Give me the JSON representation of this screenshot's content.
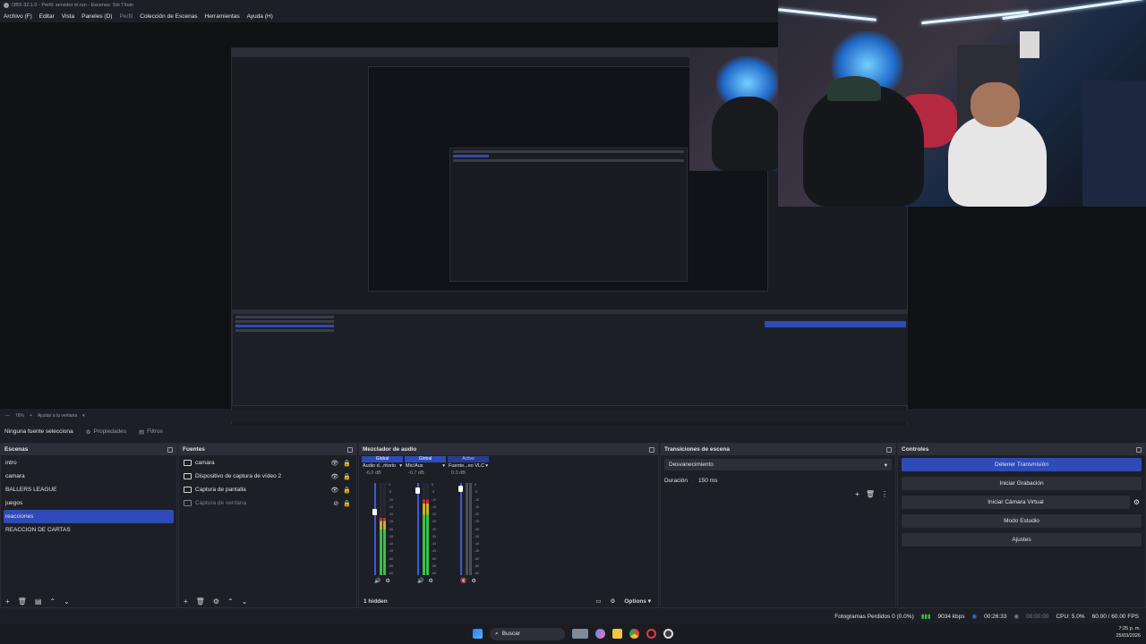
{
  "window": {
    "title": "OBS 32.1.0 - Perfil: servidor irl.run - Escenas: Sin Título"
  },
  "menu": [
    {
      "label": "Archivo (F)",
      "dim": false
    },
    {
      "label": "Editar",
      "dim": false
    },
    {
      "label": "Vista",
      "dim": false
    },
    {
      "label": "Paneles (D)",
      "dim": false
    },
    {
      "label": "Perfil",
      "dim": true
    },
    {
      "label": "Colección de Escenas",
      "dim": false
    },
    {
      "label": "Herramientas",
      "dim": false
    },
    {
      "label": "Ayuda (H)",
      "dim": false
    }
  ],
  "zoom": {
    "value": "76%",
    "mode": "Ajustar a la ventana"
  },
  "context": {
    "source": "Ninguna fuente selecciona",
    "properties": "Propiedades",
    "filters": "Filtros"
  },
  "scenes": {
    "title": "Escenas",
    "items": [
      {
        "label": "intro",
        "selected": false
      },
      {
        "label": "camara",
        "selected": false
      },
      {
        "label": "BALLERS LEAGUE",
        "selected": false
      },
      {
        "label": "juegos",
        "selected": false
      },
      {
        "label": "reacciones",
        "selected": true
      },
      {
        "label": "REACCION DE CARTAS",
        "selected": false
      }
    ]
  },
  "sources": {
    "title": "Fuentes",
    "items": [
      {
        "label": "camara",
        "icon": "list-icon",
        "visible": true
      },
      {
        "label": "Dispositivo de captura de vídeo 2",
        "icon": "camera-icon",
        "visible": true
      },
      {
        "label": "Captura de pantalla",
        "icon": "monitor-icon",
        "visible": true
      },
      {
        "label": "Captura de ventana",
        "icon": "window-icon",
        "visible": false
      }
    ]
  },
  "mixer": {
    "title": "Mezclador de audio",
    "channels": [
      {
        "header": "Global",
        "name": "Audio d...ritorio",
        "db": "-6.0 dB",
        "level": 0.62,
        "fader": 0.72,
        "active": false
      },
      {
        "header": "Global",
        "name": "Mic/Aux",
        "db": "-0.7 dB",
        "level": 0.82,
        "fader": 0.95,
        "active": false
      },
      {
        "header": "Activo",
        "name": "Fuente...eo VLC",
        "db": "0.0 dB",
        "level": 0.0,
        "fader": 0.97,
        "active": true
      }
    ],
    "hidden": "1 hidden",
    "options": "Options",
    "ticks": [
      "0",
      "-5",
      "-10",
      "-15",
      "-20",
      "-25",
      "-30",
      "-35",
      "-40",
      "-45",
      "-50",
      "-55",
      "-60"
    ]
  },
  "transitions": {
    "title": "Transiciones de escena",
    "type": "Desvanecimiento",
    "duration_label": "Duración",
    "duration_value": "150 ms"
  },
  "controls": {
    "title": "Controles",
    "buttons": [
      {
        "label": "Detener Transmisión",
        "primary": true
      },
      {
        "label": "Iniciar Grabación",
        "primary": false
      },
      {
        "label": "Iniciar Cámara Virtual",
        "primary": false
      },
      {
        "label": "Modo Estudio",
        "primary": false
      },
      {
        "label": "Ajustes",
        "primary": false
      }
    ]
  },
  "status": {
    "dropped": "Fotogramas Perdidos 0 (0.0%)",
    "bitrate": "9034 kbps",
    "stream_time": "00:26:33",
    "rec_time": "00:00:00",
    "cpu": "CPU: 5.0%",
    "fps": "60.00 / 60.00 FPS"
  },
  "taskbar": {
    "search": "Buscar",
    "time": "7:25 p. m.",
    "date": "25/03/2026"
  },
  "colors": {
    "accent": "#2f4bb8",
    "bg": "#1d1f26",
    "meter_green": "#3cc04a",
    "meter_yellow": "#c7b22a",
    "meter_red": "#c43030"
  }
}
